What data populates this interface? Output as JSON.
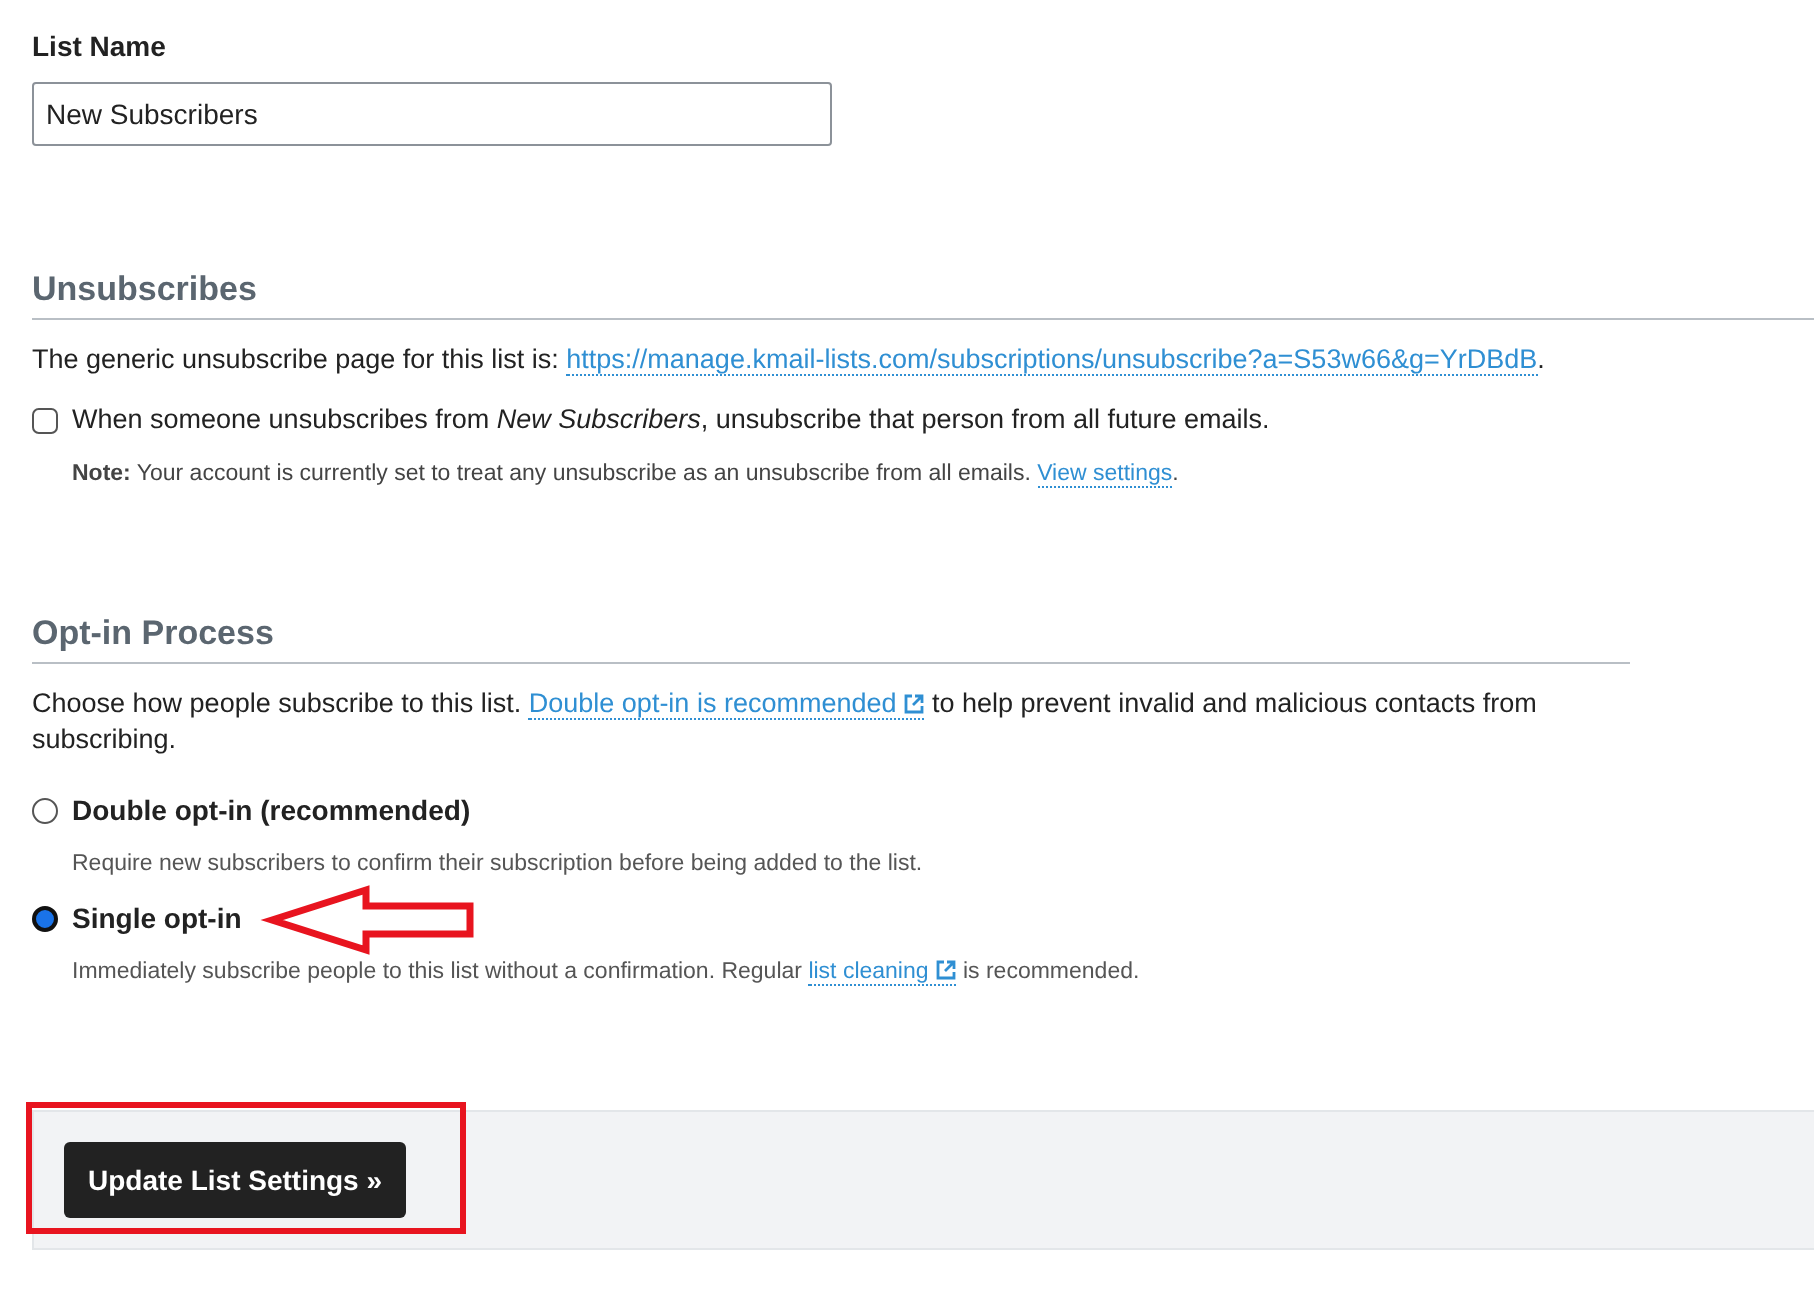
{
  "list_name": {
    "label": "List Name",
    "value": "New Subscribers"
  },
  "unsubscribes": {
    "heading": "Unsubscribes",
    "page_text": {
      "before": "The generic unsubscribe page for this list is: ",
      "link": {
        "text": "https://manage.kmail-lists.com/subscriptions/unsubscribe?a=S53w66&g=YrDBdB"
      },
      "after": "."
    },
    "checkbox": {
      "label": "When someone unsubscribes from *New Subscribers*, unsubscribe that person from all future emails.",
      "checked": false
    },
    "note": {
      "before": "**Note:** Your account is currently set to treat any unsubscribe as an unsubscribe from all emails. ",
      "link": {
        "text": "View settings"
      },
      "after": "."
    }
  },
  "opt_in": {
    "heading": "Opt-in Process",
    "intro": {
      "before": "Choose how people subscribe to this list. ",
      "link": {
        "text": "Double opt-in is recommended",
        "external": true
      },
      "after": " to help prevent invalid and malicious contacts from subscribing."
    },
    "options": [
      {
        "label": "Double opt-in (recommended)",
        "description": {
          "before": "Require new subscribers to confirm their subscription before being added to the list."
        },
        "selected": false
      },
      {
        "label": "Single opt-in",
        "description": {
          "before": "Immediately subscribe people to this list without a confirmation. Regular ",
          "link": {
            "text": "list cleaning",
            "external": true
          },
          "after": " is recommended."
        },
        "selected": true,
        "annotation": {
          "kind": "arrow"
        }
      }
    ]
  },
  "footer": {
    "button": "Update List Settings »",
    "annotation": {
      "kind": "frame"
    }
  }
}
